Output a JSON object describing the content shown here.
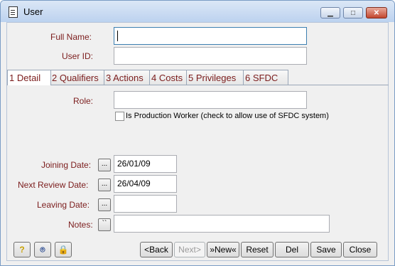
{
  "window": {
    "title": "User",
    "minimize_symbol": "▁",
    "maximize_symbol": "□",
    "close_symbol": "✕",
    "help_symbol": "?",
    "binoculars_symbol": "⌾",
    "lock_symbol": "🔒"
  },
  "fields": {
    "full_name_label": "Full Name:",
    "user_id_label": "User ID:"
  },
  "tabs": [
    {
      "label": "1 Detail"
    },
    {
      "label": "2 Qualifiers"
    },
    {
      "label": "3 Actions"
    },
    {
      "label": "4 Costs"
    },
    {
      "label": "5 Privileges"
    },
    {
      "label": "6 SFDC"
    }
  ],
  "detail": {
    "role_label": "Role:",
    "production_worker_label": "Is Production Worker (check to allow use of SFDC system)",
    "joining_date_label": "Joining Date:",
    "joining_date_value": "26/01/09",
    "next_review_date_label": "Next Review Date:",
    "next_review_date_value": "26/04/09",
    "leaving_date_label": "Leaving Date:",
    "leaving_date_value": "",
    "notes_label": "Notes:",
    "notes_value": "",
    "ellipsis_label": "...",
    "notes_button_label": "``"
  },
  "toolbar": {
    "back_label": "<Back",
    "next_label": "Next>",
    "new_label": "»New«",
    "reset_label": "Reset",
    "del_label": "Del",
    "save_label": "Save",
    "close_label": "Close"
  }
}
